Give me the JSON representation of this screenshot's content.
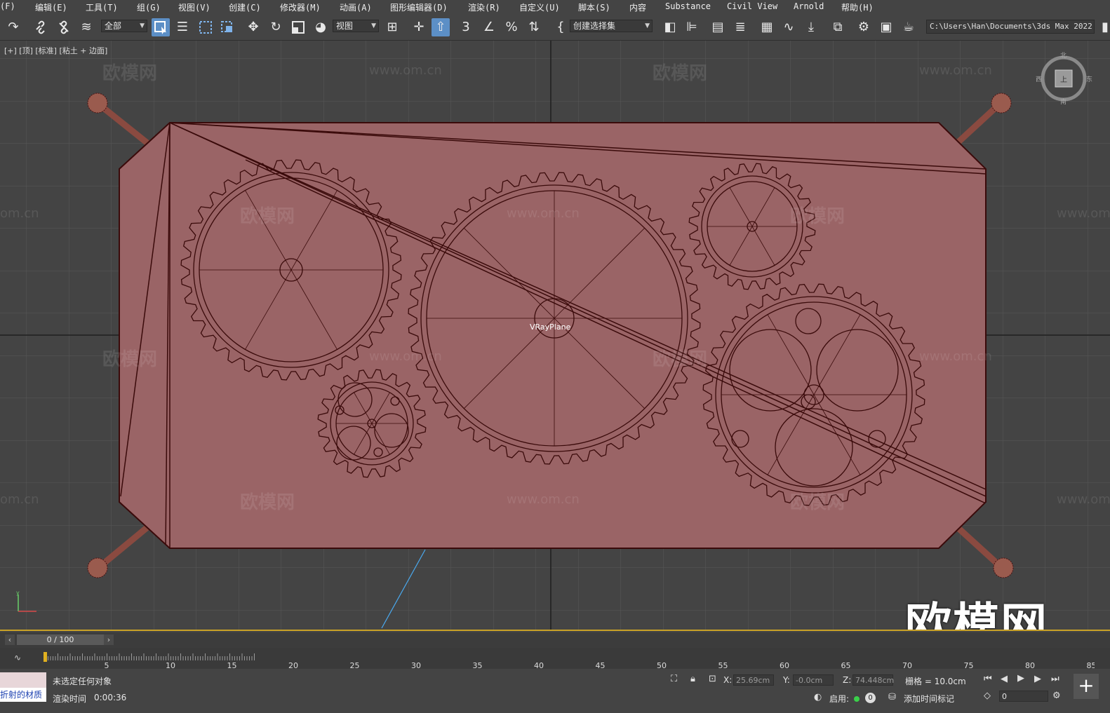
{
  "menu": [
    "(F)",
    "编辑(E)",
    "工具(T)",
    "组(G)",
    "视图(V)",
    "创建(C)",
    "修改器(M)",
    "动画(A)",
    "图形编辑器(D)",
    "渲染(R)",
    "自定义(U)",
    "脚本(S)",
    "内容",
    "Substance",
    "Civil View",
    "Arnold",
    "帮助(H)"
  ],
  "toolbar": {
    "filter_dropdown": "全部",
    "coord_dropdown": "视图",
    "selection_set_dropdown": "创建选择集",
    "project_path": "C:\\Users\\Han\\Documents\\3ds Max 2022"
  },
  "viewport": {
    "label": "[+] [顶] [标准] [粘土 + 边面]",
    "object_label": "VRayPlane",
    "watermark_cn": "欧模网",
    "watermark_url": "www.om.cn",
    "watermark_url_partial": "om.cn",
    "watermark_url_cut": "www.om.cn",
    "big_watermark": "欧模网",
    "viewcube": {
      "north": "北",
      "south": "南",
      "west": "西",
      "east": "东",
      "face": "上"
    },
    "colors": {
      "object_fill": "#9a6466",
      "wire": "#3a0a0a",
      "grid": "#575757",
      "background": "#444444"
    }
  },
  "timeline": {
    "frame_display": "0 / 100",
    "ticks": [
      "5",
      "10",
      "15",
      "20",
      "25",
      "30",
      "35",
      "40",
      "45",
      "50",
      "55",
      "60",
      "65",
      "70",
      "75",
      "80",
      "85"
    ]
  },
  "status": {
    "material_label": "折射的材质",
    "selection_text": "未选定任何对象",
    "render_time_label": "渲染时间",
    "render_time_value": "0:00:36",
    "x_label": "X:",
    "x_value": "25.69cm",
    "y_label": "Y:",
    "y_value": "-0.0cm",
    "z_label": "Z:",
    "z_value": "74.448cm",
    "grid_label": "栅格 = 10.0cm",
    "enable_label": "启用:",
    "enable_count": "0",
    "add_time_tag": "添加时间标记",
    "frame_field": "0"
  }
}
